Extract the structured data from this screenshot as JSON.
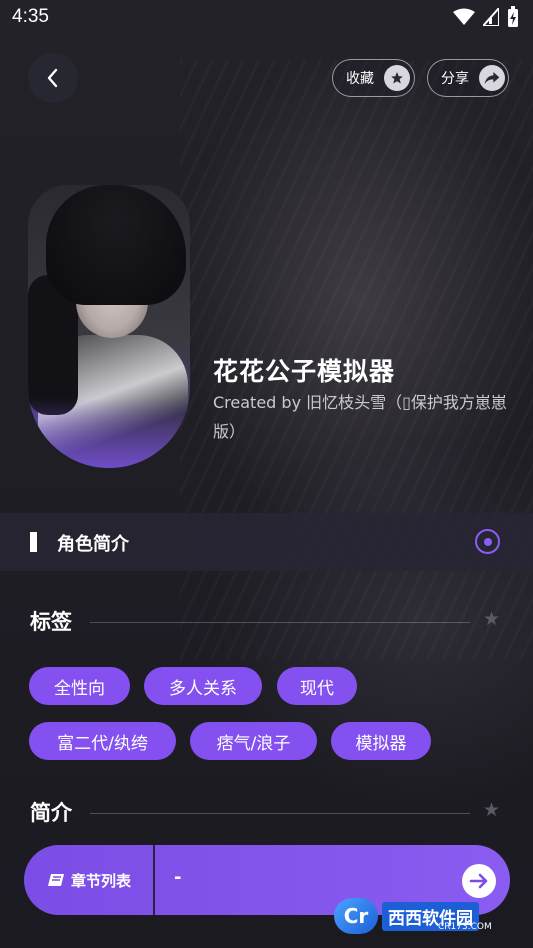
{
  "status_bar": {
    "time": "4:35"
  },
  "header": {
    "favorite_label": "收藏",
    "share_label": "分享"
  },
  "character": {
    "title": "花花公子模拟器",
    "creator": "Created by 旧忆枝头雪（▯保护我方崽崽版）"
  },
  "role_section": {
    "label": "角色简介"
  },
  "tags_section": {
    "title": "标签",
    "tags": [
      "全性向",
      "多人关系",
      "现代",
      "富二代/纨绔",
      "痞气/浪子",
      "模拟器"
    ]
  },
  "intro_section": {
    "title": "简介"
  },
  "action_bar": {
    "chapter_label": "章节列表",
    "current_chapter": "-"
  },
  "watermark": {
    "logo_text": "Cr",
    "name": "西西软件园",
    "url": "CR173.COM"
  },
  "colors": {
    "accent": "#8451f0",
    "background": "#1f1e25"
  }
}
